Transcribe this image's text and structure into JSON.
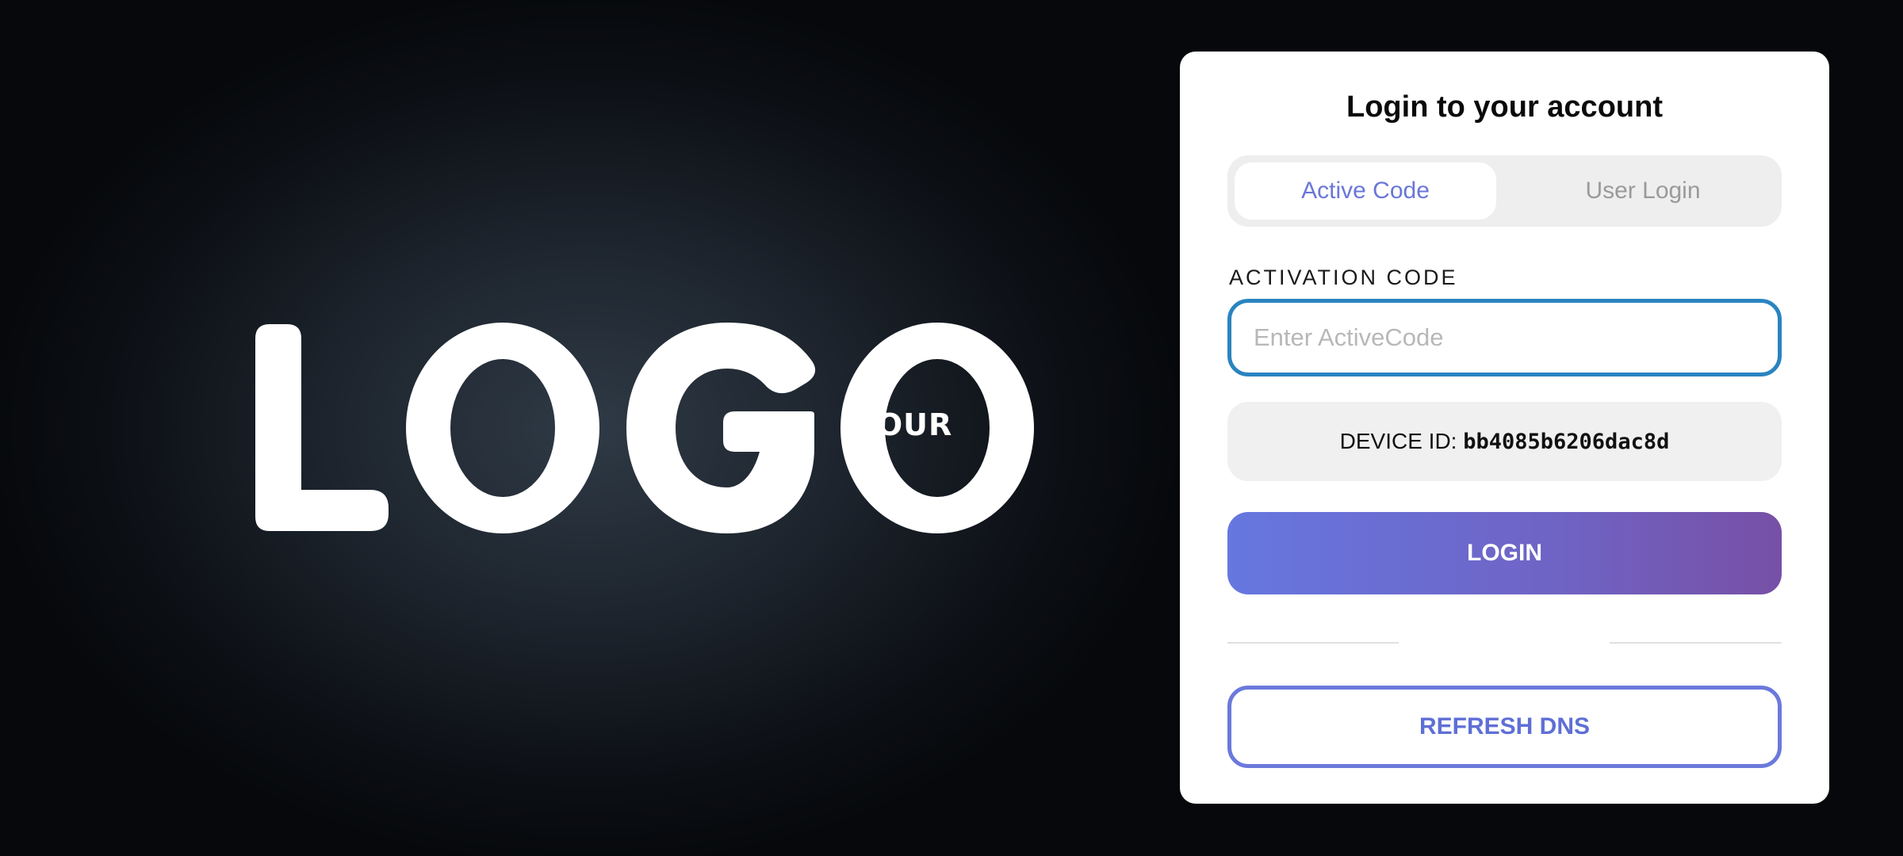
{
  "logo": {
    "word": "YOUR",
    "brand_text": "LOGO",
    "color": "#ffffff"
  },
  "login_card": {
    "title": "Login to your account",
    "tabs": [
      {
        "label": "Active Code",
        "active": true
      },
      {
        "label": "User Login",
        "active": false
      }
    ],
    "activation_label": "ACTIVATION CODE",
    "activation_input": {
      "value": "",
      "placeholder": "Enter ActiveCode"
    },
    "device_id_label": "DEVICE ID:",
    "device_id_value": "bb4085b6206dac8d",
    "login_button": "LOGIN",
    "divider_text": "",
    "refresh_button": "REFRESH DNS",
    "colors": {
      "accent": "#6a77d8",
      "input_focus_border": "#2a84c0",
      "login_gradient_start": "#6677e0",
      "login_gradient_end": "#7750a6"
    }
  }
}
